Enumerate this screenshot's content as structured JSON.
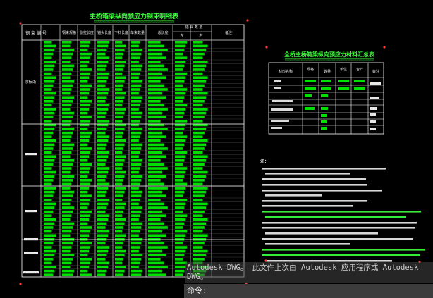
{
  "drawing": {
    "table1_title": "主桥箱梁纵向预应力钢束明细表",
    "table1_header": {
      "col1": "钢 束 编 号",
      "col2": "钢束规格",
      "col3": "张拉长度",
      "col4": "锚头长度",
      "col5": "下料长度",
      "col6": "单束数量",
      "col7": "总长度",
      "col8_group": "锚 具 数 量",
      "col8a": "左",
      "col8b": "右",
      "col9": "备注"
    },
    "table1_row_labels": [
      "顶板束",
      "腹板束",
      "底板束"
    ],
    "table2_title": "全桥主桥箱梁纵向预应力材料汇总表",
    "table2_header": [
      "材料名称",
      "规格",
      "数量",
      "单位",
      "合计",
      "备注"
    ],
    "notes_heading": "注：",
    "notes_count": 10
  },
  "status": {
    "line1": "Autodesk DWG。  此文件上次由 Autodesk 应用程序或 Autodesk",
    "line2": "DWG。"
  },
  "command": {
    "prompt": "命令:"
  },
  "colors": {
    "background": "#000000",
    "table_fill": "#00e000",
    "title": "#3dff3d",
    "line": "#ffffff",
    "marker": "#ff3b3b"
  }
}
